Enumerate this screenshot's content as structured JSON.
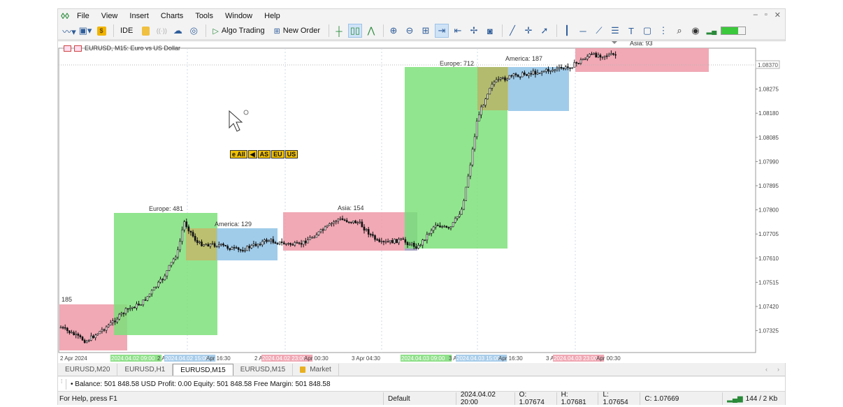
{
  "menu": {
    "items": [
      "File",
      "View",
      "Insert",
      "Charts",
      "Tools",
      "Window",
      "Help"
    ],
    "window_controls": [
      "–",
      "▫",
      "✕"
    ]
  },
  "toolbar": {
    "algo_trading_label": "Algo Trading",
    "new_order_label": "New Order",
    "ide_label": "IDE"
  },
  "chart": {
    "title": "EURUSD, M15:  Euro vs US Dollar",
    "current_price_label": "1.08370",
    "panel_buttons": [
      "e All",
      "◀",
      "AS",
      "EU",
      "US"
    ],
    "price_ticks": [
      "1.08370",
      "1.08275",
      "1.08180",
      "1.08085",
      "1.07990",
      "1.07895",
      "1.07800",
      "1.07705",
      "1.07610",
      "1.07515",
      "1.07420",
      "1.07325"
    ],
    "time_labels": [
      {
        "text": "2 Apr 2024",
        "hl": ""
      },
      {
        "text": "2024.04.02 09:00",
        "hl": "green"
      },
      {
        "text": "2 A",
        "hl": ""
      },
      {
        "text": "2024.04.02 15:00",
        "hl": "blue"
      },
      {
        "text": "Apr 16:30",
        "hl": ""
      },
      {
        "text": "2 A",
        "hl": ""
      },
      {
        "text": "2024.04.02 23:00",
        "hl": "red"
      },
      {
        "text": "Apr 00:30",
        "hl": ""
      },
      {
        "text": "3 Apr 04:30",
        "hl": ""
      },
      {
        "text": "2024.04.03 09:00",
        "hl": "green"
      },
      {
        "text": "3 A",
        "hl": ""
      },
      {
        "text": "2024.04.03 15:00",
        "hl": "blue"
      },
      {
        "text": "Apr 16:30",
        "hl": ""
      },
      {
        "text": "3 A",
        "hl": ""
      },
      {
        "text": "2024.04.03 23:00",
        "hl": "red"
      },
      {
        "text": "Apr 00:30",
        "hl": ""
      }
    ],
    "sessions": [
      {
        "name": "asia-1",
        "label": "185",
        "color": "#ee9aa8"
      },
      {
        "name": "europe-1",
        "label": "Europe: 481",
        "color": "#7ee07a"
      },
      {
        "name": "america-1",
        "label": "America: 129",
        "color": "#8fc3e6"
      },
      {
        "name": "asia-2",
        "label": "Asia: 154",
        "color": "#ee9aa8"
      },
      {
        "name": "europe-2",
        "label": "Europe: 712",
        "color": "#7ee07a"
      },
      {
        "name": "america-2",
        "label": "America: 187",
        "color": "#8fc3e6"
      },
      {
        "name": "asia-3",
        "label": "Asia: 93",
        "color": "#ee9aa8"
      }
    ]
  },
  "tabs": [
    {
      "label": "EURUSD,M20",
      "active": false
    },
    {
      "label": "EURUSD,H1",
      "active": false
    },
    {
      "label": "EURUSD,M15",
      "active": true
    },
    {
      "label": "EURUSD,M15",
      "active": false
    },
    {
      "label": "Market",
      "active": false
    }
  ],
  "account": {
    "text": "•  Balance: 501 848.58 USD  Profit: 0.00  Equity: 501 848.58  Free Margin: 501 848.58"
  },
  "status": {
    "help": "For Help, press F1",
    "profile": "Default",
    "datetime": "2024.04.02 20:00",
    "open": "O: 1.07674",
    "high": "H: 1.07681",
    "low": "L: 1.07654",
    "close": "C: 1.07669",
    "traffic": "144 / 2 Kb"
  }
}
